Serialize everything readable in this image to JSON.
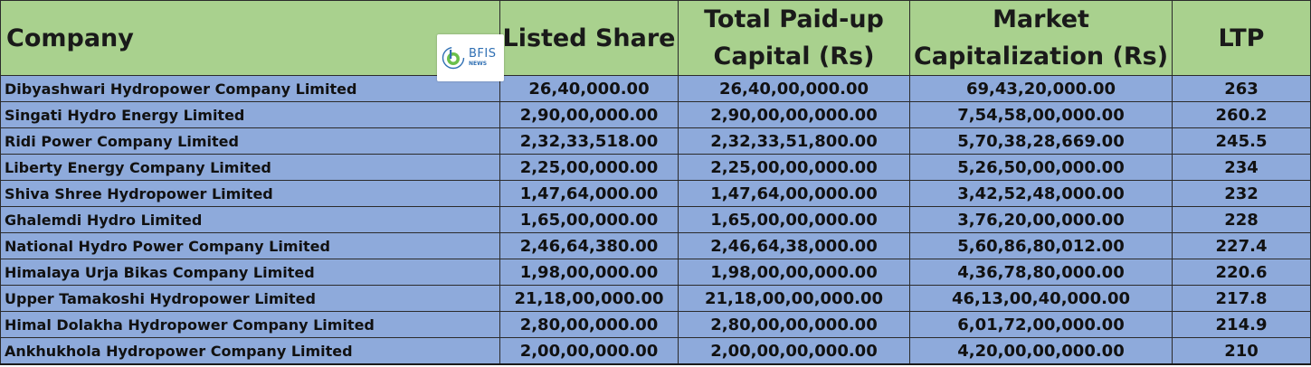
{
  "table": {
    "headers": {
      "company": "Company",
      "listed_share": "Listed Share",
      "paid_up_line1": "Total Paid-up",
      "paid_up_line2": "Capital (Rs)",
      "market_cap_line1": "Market",
      "market_cap_line2": "Capitalization (Rs)",
      "ltp": "LTP"
    },
    "rows": [
      {
        "company": "Dibyashwari Hydropower Company Limited",
        "listed_share": "26,40,000.00",
        "paid_up": "26,40,00,000.00",
        "market_cap": "69,43,20,000.00",
        "ltp": "263"
      },
      {
        "company": "Singati Hydro Energy Limited",
        "listed_share": "2,90,00,000.00",
        "paid_up": "2,90,00,00,000.00",
        "market_cap": "7,54,58,00,000.00",
        "ltp": "260.2"
      },
      {
        "company": "Ridi Power Company Limited",
        "listed_share": "2,32,33,518.00",
        "paid_up": "2,32,33,51,800.00",
        "market_cap": "5,70,38,28,669.00",
        "ltp": "245.5"
      },
      {
        "company": "Liberty Energy Company Limited",
        "listed_share": "2,25,00,000.00",
        "paid_up": "2,25,00,00,000.00",
        "market_cap": "5,26,50,00,000.00",
        "ltp": "234"
      },
      {
        "company": "Shiva Shree Hydropower Limited",
        "listed_share": "1,47,64,000.00",
        "paid_up": "1,47,64,00,000.00",
        "market_cap": "3,42,52,48,000.00",
        "ltp": "232"
      },
      {
        "company": "Ghalemdi Hydro Limited",
        "listed_share": "1,65,00,000.00",
        "paid_up": "1,65,00,00,000.00",
        "market_cap": "3,76,20,00,000.00",
        "ltp": "228"
      },
      {
        "company": "National Hydro Power Company Limited",
        "listed_share": "2,46,64,380.00",
        "paid_up": "2,46,64,38,000.00",
        "market_cap": "5,60,86,80,012.00",
        "ltp": "227.4"
      },
      {
        "company": "Himalaya Urja Bikas Company Limited",
        "listed_share": "1,98,00,000.00",
        "paid_up": "1,98,00,00,000.00",
        "market_cap": "4,36,78,80,000.00",
        "ltp": "220.6"
      },
      {
        "company": "Upper Tamakoshi Hydropower Limited",
        "listed_share": "21,18,00,000.00",
        "paid_up": "21,18,00,00,000.00",
        "market_cap": "46,13,00,40,000.00",
        "ltp": "217.8"
      },
      {
        "company": "Himal Dolakha Hydropower Company Limited",
        "listed_share": "2,80,00,000.00",
        "paid_up": "2,80,00,00,000.00",
        "market_cap": "6,01,72,00,000.00",
        "ltp": "214.9"
      },
      {
        "company": "Ankhukhola Hydropower Company Limited",
        "listed_share": "2,00,00,000.00",
        "paid_up": "2,00,00,00,000.00",
        "market_cap": "4,20,00,00,000.00",
        "ltp": "210"
      }
    ]
  },
  "watermark": {
    "brand": "BFIS",
    "sub": "NEWS",
    "icon": "bfis-logo-icon"
  },
  "colors": {
    "header_bg": "#a9d18e",
    "row_bg": "#8eaadb",
    "logo_blue": "#2f6fb3",
    "logo_green": "#6abf4b"
  }
}
